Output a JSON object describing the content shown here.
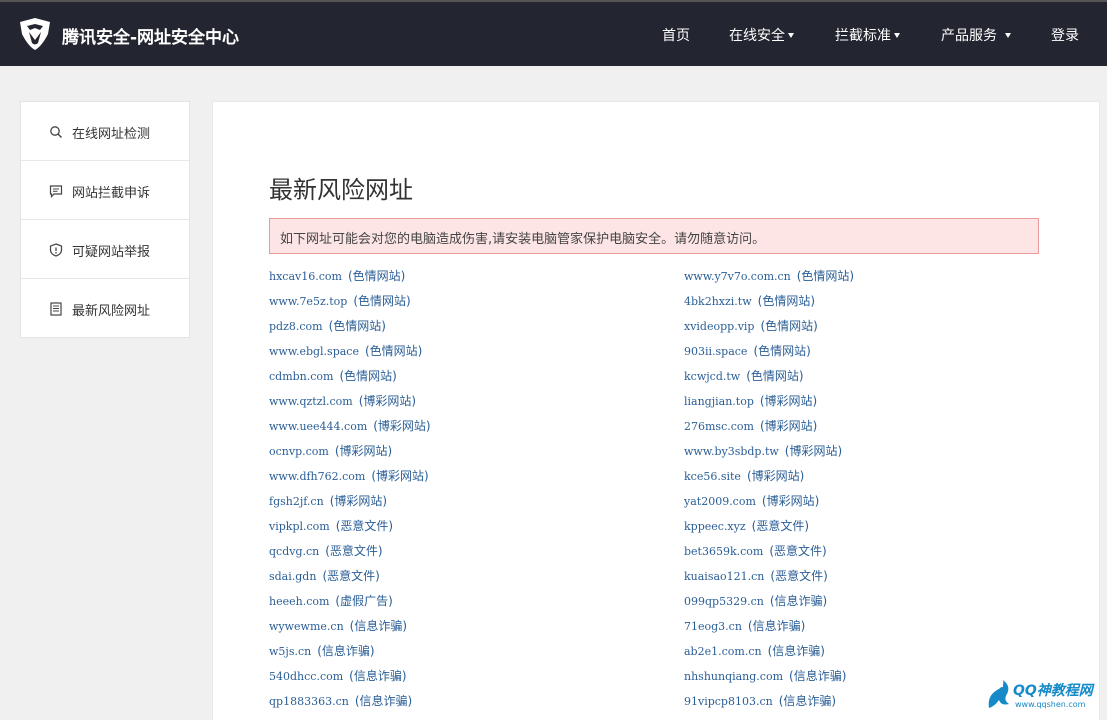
{
  "header": {
    "brand": "腾讯安全-网址安全中心",
    "nav": [
      {
        "label": "首页",
        "dropdown": false
      },
      {
        "label": "在线安全",
        "dropdown": true
      },
      {
        "label": "拦截标准",
        "dropdown": true
      },
      {
        "label": "产品服务",
        "dropdown": true
      },
      {
        "label": "登录",
        "dropdown": false
      }
    ]
  },
  "sidebar": {
    "items": [
      {
        "label": "在线网址检测",
        "icon": "search-icon"
      },
      {
        "label": "网站拦截申诉",
        "icon": "chat-icon"
      },
      {
        "label": "可疑网站举报",
        "icon": "shield-icon"
      },
      {
        "label": "最新风险网址",
        "icon": "document-icon"
      }
    ]
  },
  "main": {
    "title": "最新风险网址",
    "alert": "如下网址可能会对您的电脑造成伤害,请安装电脑管家保护电脑安全。请勿随意访问。",
    "left_urls": [
      {
        "url": "hxcav16.com",
        "tag": "(色情网站)"
      },
      {
        "url": "www.7e5z.top",
        "tag": "(色情网站)"
      },
      {
        "url": "pdz8.com",
        "tag": "(色情网站)"
      },
      {
        "url": "www.ebgl.space",
        "tag": "(色情网站)"
      },
      {
        "url": "cdmbn.com",
        "tag": "(色情网站)"
      },
      {
        "url": "www.qztzl.com",
        "tag": "(博彩网站)"
      },
      {
        "url": "www.uee444.com",
        "tag": "(博彩网站)"
      },
      {
        "url": "ocnvp.com",
        "tag": "(博彩网站)"
      },
      {
        "url": "www.dfh762.com",
        "tag": "(博彩网站)"
      },
      {
        "url": "fgsh2jf.cn",
        "tag": "(博彩网站)"
      },
      {
        "url": "vipkpl.com",
        "tag": "(恶意文件)"
      },
      {
        "url": "qcdvg.cn",
        "tag": "(恶意文件)"
      },
      {
        "url": "sdai.gdn",
        "tag": "(恶意文件)"
      },
      {
        "url": "heeeh.com",
        "tag": "(虚假广告)"
      },
      {
        "url": "wywewme.cn",
        "tag": "(信息诈骗)"
      },
      {
        "url": "w5js.cn",
        "tag": "(信息诈骗)"
      },
      {
        "url": "540dhcc.com",
        "tag": "(信息诈骗)"
      },
      {
        "url": "qp1883363.cn",
        "tag": "(信息诈骗)"
      }
    ],
    "right_urls": [
      {
        "url": "www.y7v7o.com.cn",
        "tag": "(色情网站)"
      },
      {
        "url": "4bk2hxzi.tw",
        "tag": "(色情网站)"
      },
      {
        "url": "xvideopp.vip",
        "tag": "(色情网站)"
      },
      {
        "url": "903ii.space",
        "tag": "(色情网站)"
      },
      {
        "url": "kcwjcd.tw",
        "tag": "(色情网站)"
      },
      {
        "url": "liangjian.top",
        "tag": "(博彩网站)"
      },
      {
        "url": "276msc.com",
        "tag": "(博彩网站)"
      },
      {
        "url": "www.by3sbdp.tw",
        "tag": "(博彩网站)"
      },
      {
        "url": "kce56.site",
        "tag": "(博彩网站)"
      },
      {
        "url": "yat2009.com",
        "tag": "(博彩网站)"
      },
      {
        "url": "kppeec.xyz",
        "tag": "(恶意文件)"
      },
      {
        "url": "bet3659k.com",
        "tag": "(恶意文件)"
      },
      {
        "url": "kuaisao121.cn",
        "tag": "(恶意文件)"
      },
      {
        "url": "099qp5329.cn",
        "tag": "(信息诈骗)"
      },
      {
        "url": "71eog3.cn",
        "tag": "(信息诈骗)"
      },
      {
        "url": "ab2e1.com.cn",
        "tag": "(信息诈骗)"
      },
      {
        "url": "nhshunqiang.com",
        "tag": "(信息诈骗)"
      },
      {
        "url": "91vipcp8103.cn",
        "tag": "(信息诈骗)"
      }
    ]
  },
  "watermark": {
    "title": "QQ神教程网",
    "url": "www.qqshen.com"
  },
  "colors": {
    "header_bg": "#232530",
    "link": "#2a5e96",
    "alert_bg": "#fde5e5",
    "alert_border": "#e99a9a"
  }
}
